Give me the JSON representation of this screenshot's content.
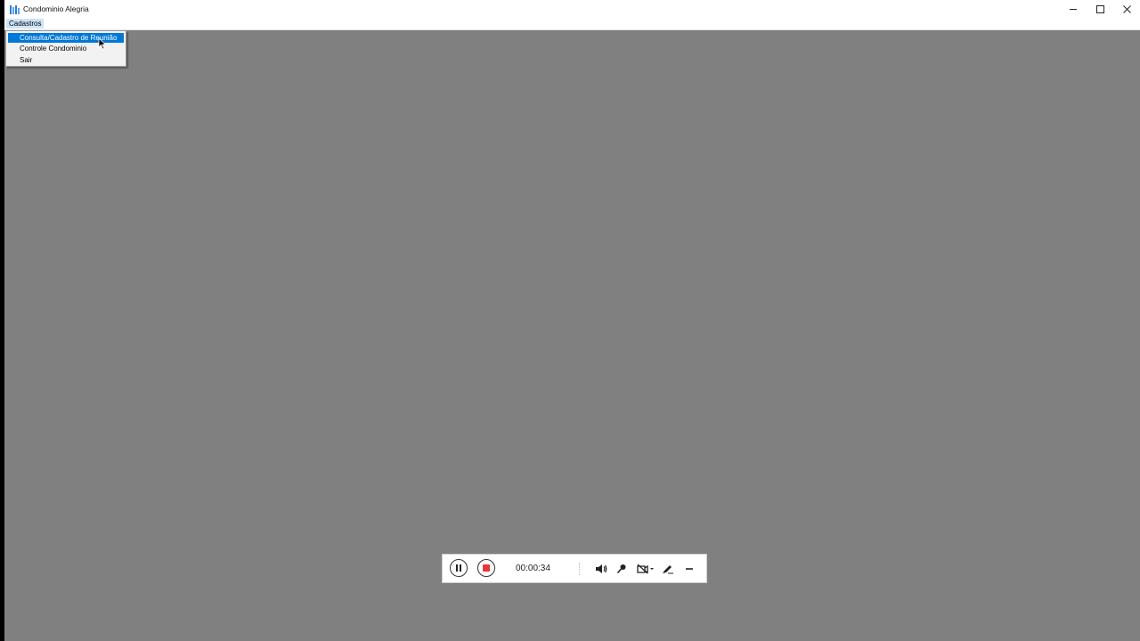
{
  "window": {
    "title": "Condominio Alegria"
  },
  "menubar": {
    "cadastros_label": "Cadastros"
  },
  "dropdown": {
    "items": [
      {
        "label": "Consulta/Cadastro de Reunião",
        "selected": true
      },
      {
        "label": "Controle Condominio",
        "selected": false
      },
      {
        "label": "Sair",
        "selected": false
      }
    ]
  },
  "recorder": {
    "time": "00:00:34",
    "icons": [
      "pause-icon",
      "stop-icon",
      "speaker-icon",
      "microphone-icon",
      "camera-off-icon",
      "pen-icon",
      "minimize-icon"
    ]
  },
  "colors": {
    "workspace": "#808080",
    "selection": "#0078d7",
    "menu_hover": "#cce4f7",
    "stop": "#e5363a"
  }
}
